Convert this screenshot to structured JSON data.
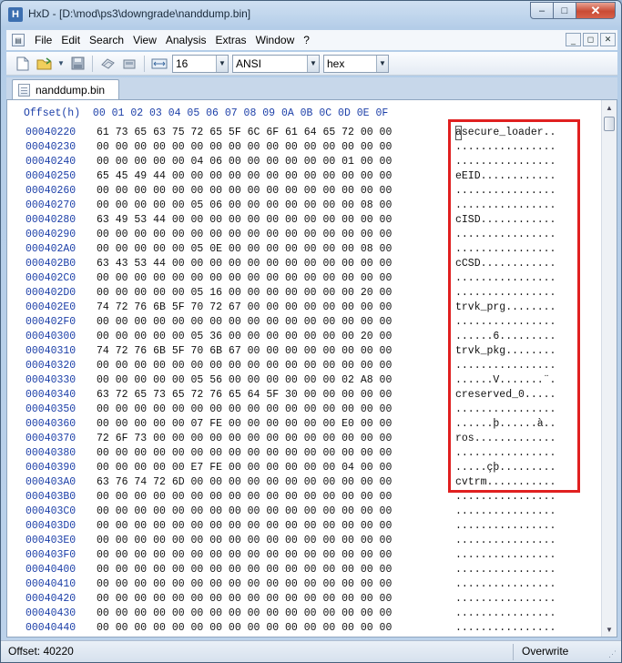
{
  "window": {
    "app_icon_glyph": "H",
    "title": "HxD - [D:\\mod\\ps3\\downgrade\\nanddump.bin]",
    "buttons": {
      "minimize": "–",
      "maximize": "□",
      "close": "✕"
    }
  },
  "menu": {
    "items": [
      "File",
      "Edit",
      "Search",
      "View",
      "Analysis",
      "Extras",
      "Window",
      "?"
    ],
    "mdi_buttons": [
      "_",
      "◻",
      "✕"
    ]
  },
  "toolbar": {
    "bytes_per_row": "16",
    "charset": "ANSI",
    "offset_base": "hex"
  },
  "tab": {
    "label": "nanddump.bin"
  },
  "editor": {
    "header": "Offset(h)  00 01 02 03 04 05 06 07 08 09 0A 0B 0C 0D 0E 0F",
    "rows": [
      {
        "offset": "00040220",
        "hex": "61 73 65 63 75 72 65 5F 6C 6F 61 64 65 72 00 00",
        "ascii": "asecure_loader.."
      },
      {
        "offset": "00040230",
        "hex": "00 00 00 00 00 00 00 00 00 00 00 00 00 00 00 00",
        "ascii": "................"
      },
      {
        "offset": "00040240",
        "hex": "00 00 00 00 00 04 06 00 00 00 00 00 00 01 00 00",
        "ascii": "................"
      },
      {
        "offset": "00040250",
        "hex": "65 45 49 44 00 00 00 00 00 00 00 00 00 00 00 00",
        "ascii": "eEID............"
      },
      {
        "offset": "00040260",
        "hex": "00 00 00 00 00 00 00 00 00 00 00 00 00 00 00 00",
        "ascii": "................"
      },
      {
        "offset": "00040270",
        "hex": "00 00 00 00 00 05 06 00 00 00 00 00 00 00 08 00",
        "ascii": "................"
      },
      {
        "offset": "00040280",
        "hex": "63 49 53 44 00 00 00 00 00 00 00 00 00 00 00 00",
        "ascii": "cISD............"
      },
      {
        "offset": "00040290",
        "hex": "00 00 00 00 00 00 00 00 00 00 00 00 00 00 00 00",
        "ascii": "................"
      },
      {
        "offset": "000402A0",
        "hex": "00 00 00 00 00 05 0E 00 00 00 00 00 00 00 08 00",
        "ascii": "................"
      },
      {
        "offset": "000402B0",
        "hex": "63 43 53 44 00 00 00 00 00 00 00 00 00 00 00 00",
        "ascii": "cCSD............"
      },
      {
        "offset": "000402C0",
        "hex": "00 00 00 00 00 00 00 00 00 00 00 00 00 00 00 00",
        "ascii": "................"
      },
      {
        "offset": "000402D0",
        "hex": "00 00 00 00 00 05 16 00 00 00 00 00 00 00 20 00",
        "ascii": "................"
      },
      {
        "offset": "000402E0",
        "hex": "74 72 76 6B 5F 70 72 67 00 00 00 00 00 00 00 00",
        "ascii": "trvk_prg........"
      },
      {
        "offset": "000402F0",
        "hex": "00 00 00 00 00 00 00 00 00 00 00 00 00 00 00 00",
        "ascii": "................"
      },
      {
        "offset": "00040300",
        "hex": "00 00 00 00 00 05 36 00 00 00 00 00 00 00 20 00",
        "ascii": "......6........."
      },
      {
        "offset": "00040310",
        "hex": "74 72 76 6B 5F 70 6B 67 00 00 00 00 00 00 00 00",
        "ascii": "trvk_pkg........"
      },
      {
        "offset": "00040320",
        "hex": "00 00 00 00 00 00 00 00 00 00 00 00 00 00 00 00",
        "ascii": "................"
      },
      {
        "offset": "00040330",
        "hex": "00 00 00 00 00 05 56 00 00 00 00 00 00 02 A8 00",
        "ascii": "......V.......¨."
      },
      {
        "offset": "00040340",
        "hex": "63 72 65 73 65 72 76 65 64 5F 30 00 00 00 00 00",
        "ascii": "creserved_0....."
      },
      {
        "offset": "00040350",
        "hex": "00 00 00 00 00 00 00 00 00 00 00 00 00 00 00 00",
        "ascii": "................"
      },
      {
        "offset": "00040360",
        "hex": "00 00 00 00 00 07 FE 00 00 00 00 00 00 E0 00 00",
        "ascii": "......þ......à.."
      },
      {
        "offset": "00040370",
        "hex": "72 6F 73 00 00 00 00 00 00 00 00 00 00 00 00 00",
        "ascii": "ros............."
      },
      {
        "offset": "00040380",
        "hex": "00 00 00 00 00 00 00 00 00 00 00 00 00 00 00 00",
        "ascii": "................"
      },
      {
        "offset": "00040390",
        "hex": "00 00 00 00 00 E7 FE 00 00 00 00 00 00 04 00 00",
        "ascii": ".....çþ........."
      },
      {
        "offset": "000403A0",
        "hex": "63 76 74 72 6D 00 00 00 00 00 00 00 00 00 00 00",
        "ascii": "cvtrm..........."
      },
      {
        "offset": "000403B0",
        "hex": "00 00 00 00 00 00 00 00 00 00 00 00 00 00 00 00",
        "ascii": "................"
      },
      {
        "offset": "000403C0",
        "hex": "00 00 00 00 00 00 00 00 00 00 00 00 00 00 00 00",
        "ascii": "................"
      },
      {
        "offset": "000403D0",
        "hex": "00 00 00 00 00 00 00 00 00 00 00 00 00 00 00 00",
        "ascii": "................"
      },
      {
        "offset": "000403E0",
        "hex": "00 00 00 00 00 00 00 00 00 00 00 00 00 00 00 00",
        "ascii": "................"
      },
      {
        "offset": "000403F0",
        "hex": "00 00 00 00 00 00 00 00 00 00 00 00 00 00 00 00",
        "ascii": "................"
      },
      {
        "offset": "00040400",
        "hex": "00 00 00 00 00 00 00 00 00 00 00 00 00 00 00 00",
        "ascii": "................"
      },
      {
        "offset": "00040410",
        "hex": "00 00 00 00 00 00 00 00 00 00 00 00 00 00 00 00",
        "ascii": "................"
      },
      {
        "offset": "00040420",
        "hex": "00 00 00 00 00 00 00 00 00 00 00 00 00 00 00 00",
        "ascii": "................"
      },
      {
        "offset": "00040430",
        "hex": "00 00 00 00 00 00 00 00 00 00 00 00 00 00 00 00",
        "ascii": "................"
      },
      {
        "offset": "00040440",
        "hex": "00 00 00 00 00 00 00 00 00 00 00 00 00 00 00 00",
        "ascii": "................"
      }
    ]
  },
  "status": {
    "offset": "Offset: 40220",
    "mode": "Overwrite"
  },
  "colors": {
    "offset_text": "#1c3fa8",
    "highlight": "#e02020"
  }
}
